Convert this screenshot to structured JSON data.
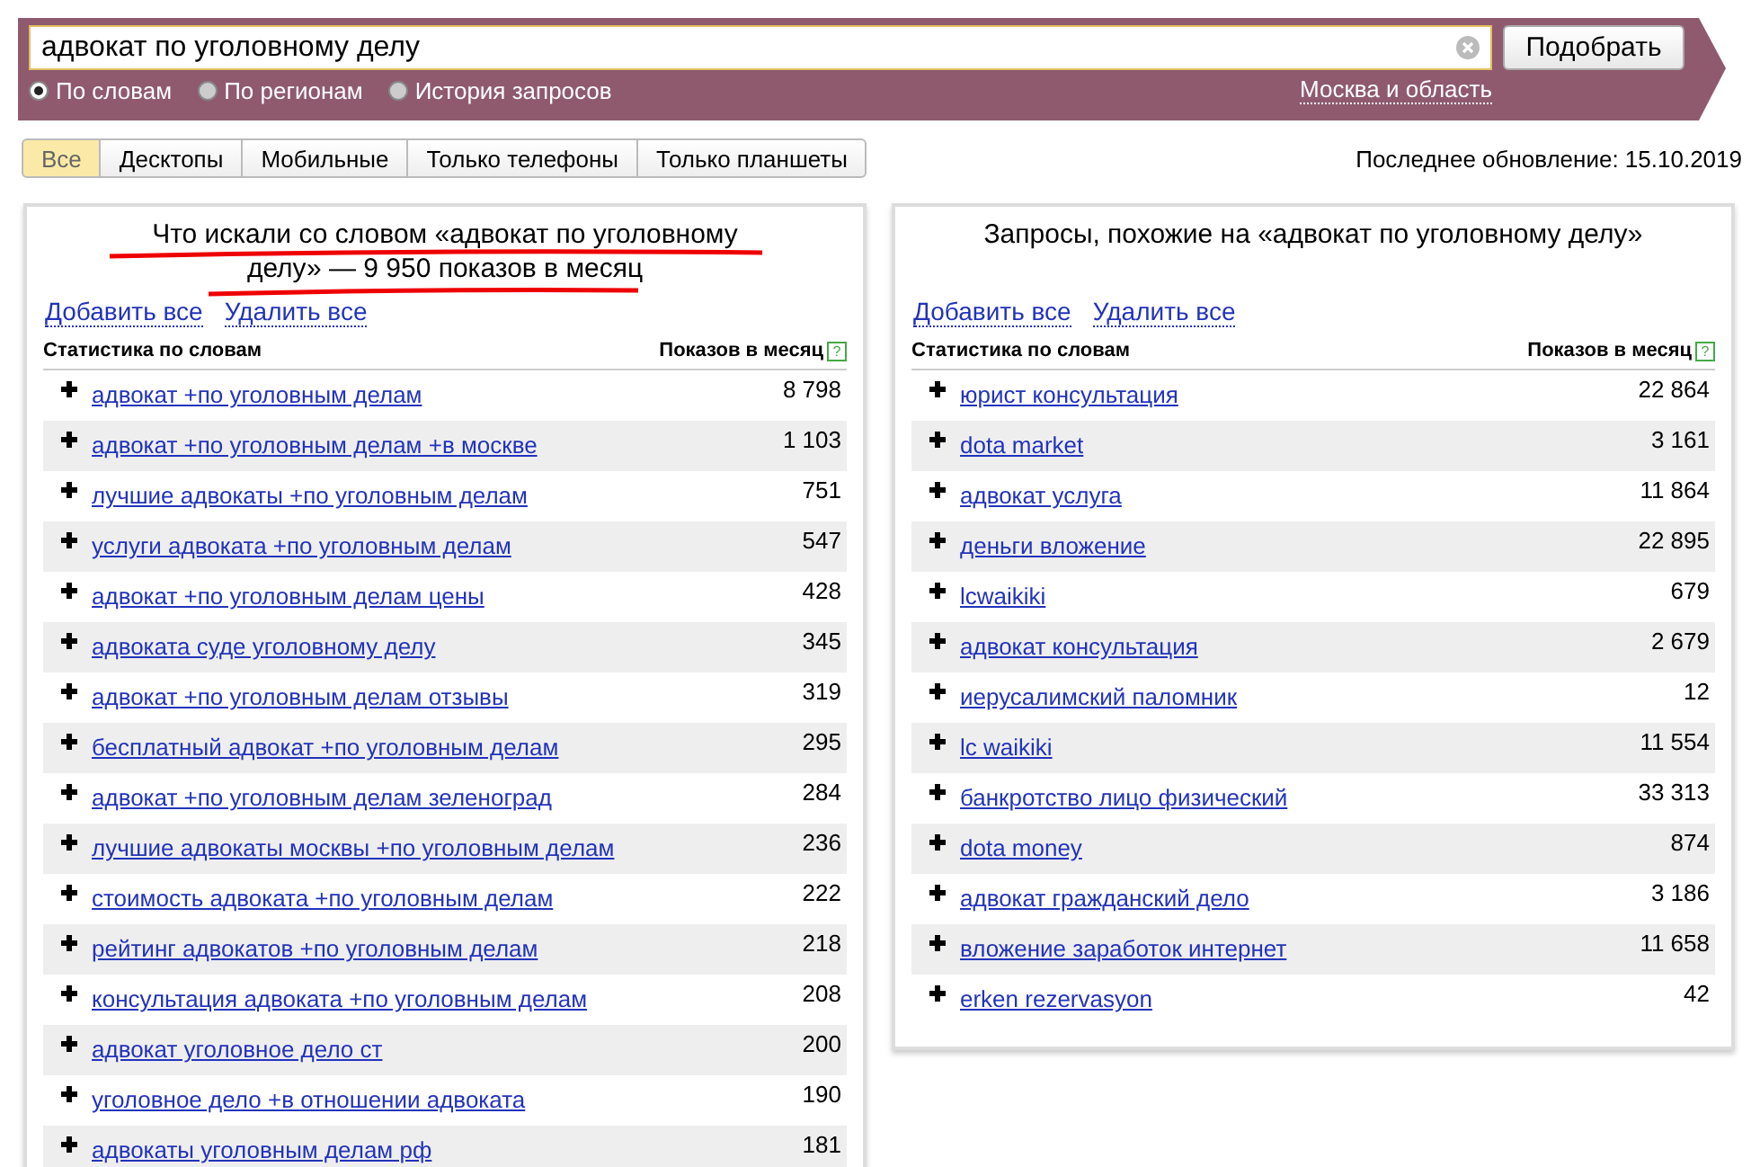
{
  "search": {
    "value": "адвокат по уголовному делу",
    "button": "Подобрать",
    "modes": [
      {
        "label": "По словам",
        "selected": true
      },
      {
        "label": "По регионам",
        "selected": false
      },
      {
        "label": "История запросов",
        "selected": false
      }
    ],
    "region": "Москва и область"
  },
  "device_tabs": [
    {
      "label": "Все",
      "selected": true
    },
    {
      "label": "Десктопы",
      "selected": false
    },
    {
      "label": "Мобильные",
      "selected": false
    },
    {
      "label": "Только телефоны",
      "selected": false
    },
    {
      "label": "Только планшеты",
      "selected": false
    }
  ],
  "last_update": "Последнее обновление: 15.10.2019",
  "panels": [
    {
      "title": "Что искали со словом «адвокат по уголовному делу» — 9 950 показов в месяц",
      "underlined": true,
      "add_all": "Добавить все",
      "remove_all": "Удалить все",
      "col_phrase": "Статистика по словам",
      "col_count": "Показов в месяц",
      "help": "?",
      "rows": [
        {
          "phrase": "адвокат +по уголовным делам",
          "count": "8 798"
        },
        {
          "phrase": "адвокат +по уголовным делам +в москве",
          "count": "1 103"
        },
        {
          "phrase": "лучшие адвокаты +по уголовным делам",
          "count": "751"
        },
        {
          "phrase": "услуги адвоката +по уголовным делам",
          "count": "547"
        },
        {
          "phrase": "адвокат +по уголовным делам цены",
          "count": "428"
        },
        {
          "phrase": "адвоката суде уголовному делу",
          "count": "345"
        },
        {
          "phrase": "адвокат +по уголовным делам отзывы",
          "count": "319"
        },
        {
          "phrase": "бесплатный адвокат +по уголовным делам",
          "count": "295"
        },
        {
          "phrase": "адвокат +по уголовным делам зеленоград",
          "count": "284"
        },
        {
          "phrase": "лучшие адвокаты москвы +по уголовным делам",
          "count": "236"
        },
        {
          "phrase": "стоимость адвоката +по уголовным делам",
          "count": "222"
        },
        {
          "phrase": "рейтинг адвокатов +по уголовным делам",
          "count": "218"
        },
        {
          "phrase": "консультация адвоката +по уголовным делам",
          "count": "208"
        },
        {
          "phrase": "адвокат уголовное дело ст",
          "count": "200"
        },
        {
          "phrase": "уголовное дело +в отношении адвоката",
          "count": "190"
        },
        {
          "phrase": "адвокаты уголовным делам рф",
          "count": "181"
        }
      ]
    },
    {
      "title": "Запросы, похожие на «адвокат по уголовному делу»",
      "underlined": false,
      "add_all": "Добавить все",
      "remove_all": "Удалить все",
      "col_phrase": "Статистика по словам",
      "col_count": "Показов в месяц",
      "help": "?",
      "rows": [
        {
          "phrase": "юрист консультация",
          "count": "22 864"
        },
        {
          "phrase": "dota market",
          "count": "3 161"
        },
        {
          "phrase": "адвокат услуга",
          "count": "11 864"
        },
        {
          "phrase": "деньги вложение",
          "count": "22 895"
        },
        {
          "phrase": "lcwaikiki",
          "count": "679"
        },
        {
          "phrase": "адвокат консультация",
          "count": "2 679"
        },
        {
          "phrase": "иерусалимский паломник",
          "count": "12"
        },
        {
          "phrase": "lc waikiki",
          "count": "11 554"
        },
        {
          "phrase": "банкротство лицо физический",
          "count": "33 313"
        },
        {
          "phrase": "dota money",
          "count": "874"
        },
        {
          "phrase": "адвокат гражданский дело",
          "count": "3 186"
        },
        {
          "phrase": "вложение заработок интернет",
          "count": "11 658"
        },
        {
          "phrase": "erken rezervasyon",
          "count": "42"
        }
      ]
    }
  ]
}
